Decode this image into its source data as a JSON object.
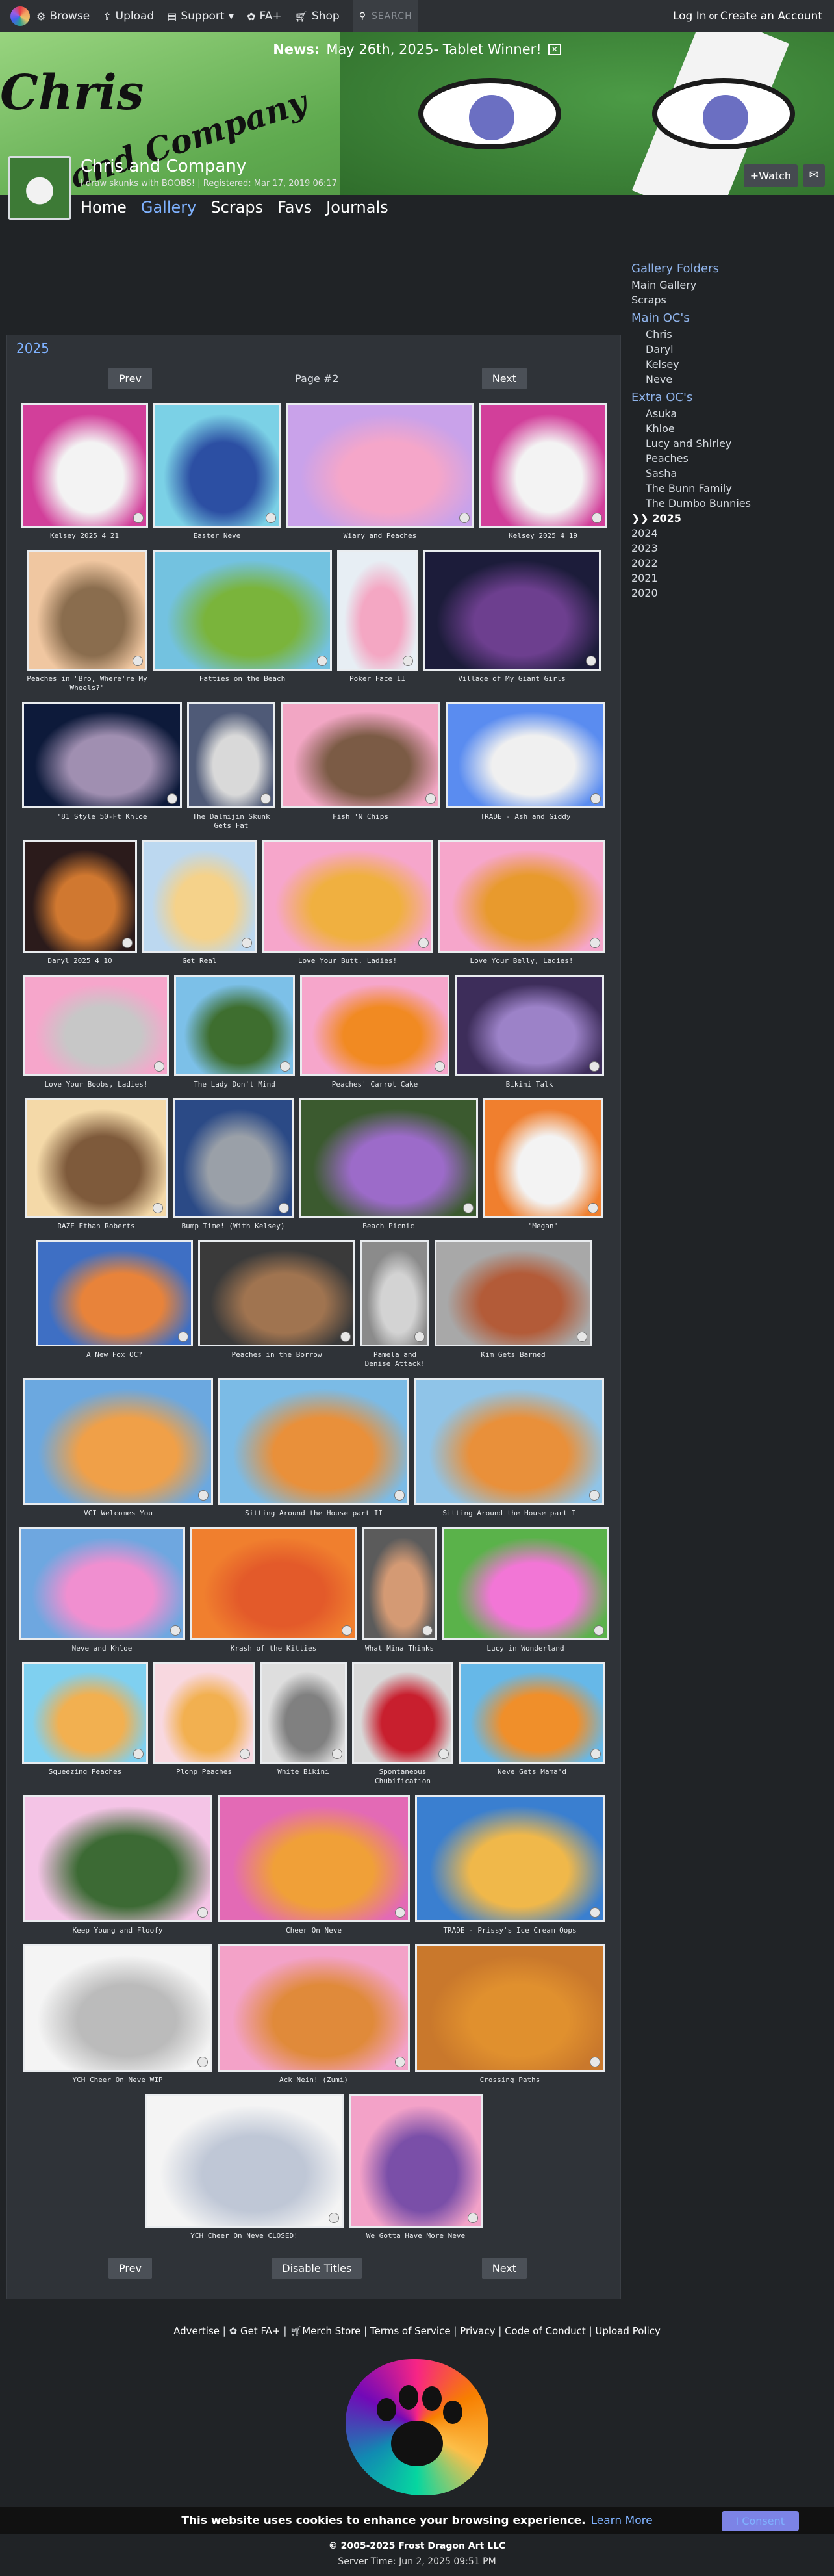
{
  "nav": {
    "browse": "Browse",
    "upload": "Upload",
    "support": "Support",
    "fa_plus": "FA+",
    "shop": "Shop",
    "search_placeholder": "SEARCH",
    "login": "Log In",
    "separator": "or",
    "create": "Create an Account"
  },
  "news": {
    "label": "News:",
    "text": "May 26th, 2025- Tablet Winner!"
  },
  "banner": {
    "wordmark_1": "Chris",
    "wordmark_2": "and Company"
  },
  "profile": {
    "name": "Chris and Company",
    "tagline": "I draw skunks with BOOBS! | Registered: Mar 17, 2019 06:17",
    "watch": "+Watch"
  },
  "subnav": [
    "Home",
    "Gallery",
    "Scraps",
    "Favs",
    "Journals"
  ],
  "sidebar": {
    "folders_heading": "Gallery Folders",
    "main_gallery": "Main Gallery",
    "scraps": "Scraps",
    "main_ocs_heading": "Main OC's",
    "main_ocs": [
      "Chris",
      "Daryl",
      "Kelsey",
      "Neve"
    ],
    "extra_ocs_heading": "Extra OC's",
    "extra_ocs": [
      "Asuka",
      "Khloe",
      "Lucy and Shirley",
      "Peaches",
      "Sasha",
      "The Bunn Family",
      "The Dumbo Bunnies"
    ],
    "years": [
      "❯❯ 2025",
      "2024",
      "2023",
      "2022",
      "2021",
      "2020"
    ]
  },
  "gallery": {
    "title": "2025",
    "prev": "Prev",
    "next": "Next",
    "page_label": "Page #2",
    "disable_titles": "Disable Titles",
    "items": [
      "Kelsey 2025 4 21",
      "Easter Neve",
      "Wiary and Peaches",
      "Kelsey 2025 4 19",
      "Peaches in \"Bro, Where're My Wheels?\"",
      "Fatties on the Beach",
      "Poker Face II",
      "Village of My Giant Girls",
      "'81 Style 50-Ft Khloe",
      "The Dalmijin Skunk Gets Fat",
      "Fish 'N Chips",
      "TRADE - Ash and Giddy",
      "Daryl 2025 4 10",
      "Get Real",
      "Love Your Butt. Ladies!",
      "Love Your Belly, Ladies!",
      "Love Your Boobs, Ladies!",
      "The Lady Don't Mind",
      "Peaches' Carrot Cake",
      "Bikini Talk",
      "RAZE Ethan Roberts",
      "Bump Time! (With Kelsey)",
      "Beach Picnic",
      "\"Megan\"",
      "A New Fox OC?",
      "Peaches in the Borrow",
      "Pamela and Denise Attack!",
      "Kim Gets Barned",
      "VCI Welcomes You",
      "Sitting Around the House part II",
      "Sitting Around the House part I",
      "Neve and Khloe",
      "Krash of the Kitties",
      "What Mina Thinks",
      "Lucy in Wonderland",
      "Squeezing Peaches",
      "Plonp Peaches",
      "White Bikini",
      "Spontaneous Chubification",
      "Neve Gets Mama'd",
      "Keep Young and Floofy",
      "Cheer On Neve",
      "TRADE - Prissy's Ice Cream Oops",
      "YCH Cheer On Neve WIP",
      "Ack Nein! (Zumi)",
      "Crossing Paths",
      "YCH Cheer On Neve CLOSED!",
      "We Gotta Have More Neve"
    ]
  },
  "footer": {
    "advertise": "Advertise",
    "get_fa": "Get FA+",
    "merch": "Merch Store",
    "tos": "Terms of Service",
    "privacy": "Privacy",
    "coc": "Code of Conduct",
    "upload_policy": "Upload Policy",
    "cookie_text": "This website uses cookies to enhance your browsing experience.",
    "learn_more": "Learn More",
    "consent": "I Consent",
    "copyright": "© 2005-2025 Frost Dragon Art LLC",
    "server_time": "Server Time: Jun 2, 2025 09:51 PM"
  },
  "colors": {
    "accent": "#7fb2ff",
    "panel": "#2f3338",
    "bg": "#202326",
    "banner_green": "#5faa4f"
  }
}
